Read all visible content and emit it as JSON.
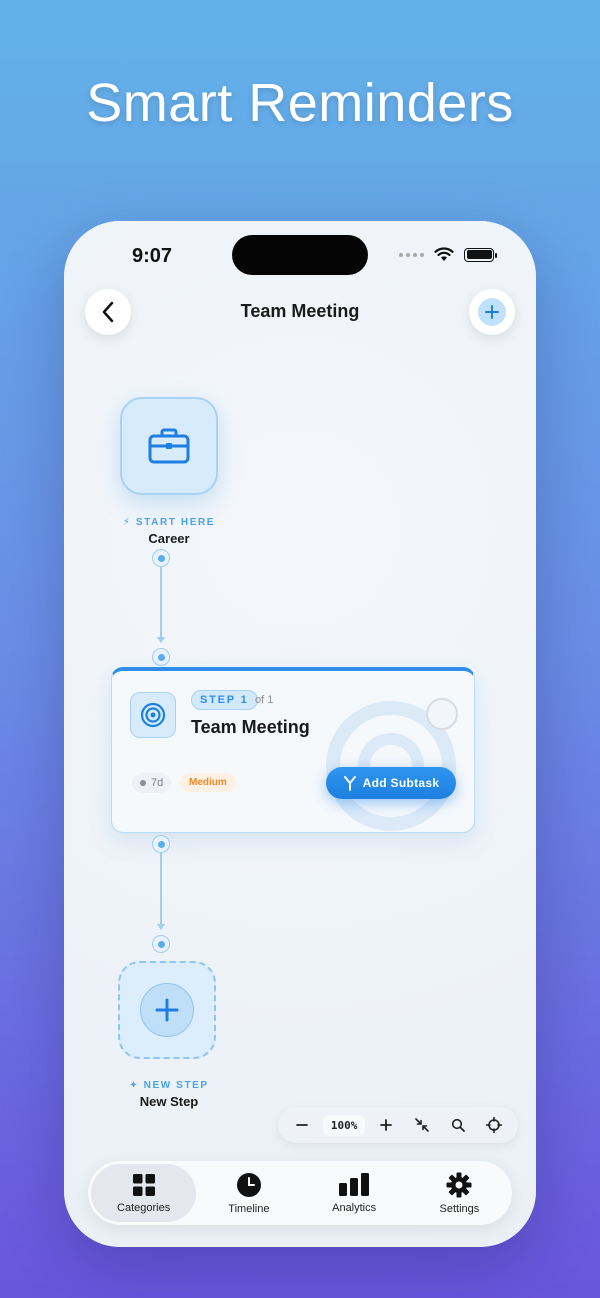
{
  "hero": {
    "title": "Smart Reminders"
  },
  "status_bar": {
    "time": "9:07"
  },
  "nav": {
    "title": "Team Meeting"
  },
  "start_node": {
    "caption_small": "START HERE",
    "label": "Career"
  },
  "step_card": {
    "badge": "STEP 1",
    "of_text": "of 1",
    "title": "Team Meeting",
    "duration": "7d",
    "priority": "Medium",
    "subtask_button": "Add Subtask"
  },
  "new_node": {
    "caption_small": "NEW STEP",
    "label": "New Step"
  },
  "zoom": {
    "level": "100%"
  },
  "tabs": [
    {
      "label": "Categories",
      "icon": "grid-icon"
    },
    {
      "label": "Timeline",
      "icon": "clock-icon"
    },
    {
      "label": "Analytics",
      "icon": "bar-chart-icon"
    },
    {
      "label": "Settings",
      "icon": "gear-icon"
    }
  ],
  "colors": {
    "accent": "#2f8fe8",
    "priority_medium": "#f08a2a"
  }
}
